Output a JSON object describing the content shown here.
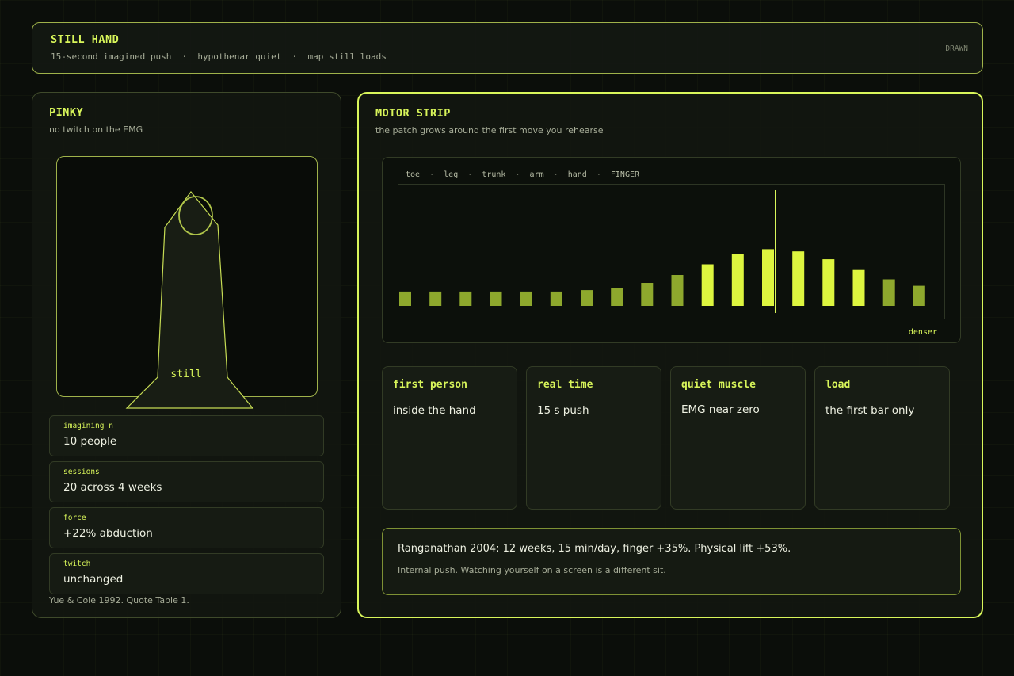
{
  "header": {
    "title": "STILL HAND",
    "subtitle": "15-second imagined push  ·  hypothenar quiet  ·  map still loads",
    "badge": "DRAWN"
  },
  "left": {
    "title": "PINKY",
    "subtitle": "no twitch on the EMG",
    "finger_label": "still",
    "stats": [
      {
        "label": "imagining n",
        "value": "10 people"
      },
      {
        "label": "sessions",
        "value": "20 across 4 weeks"
      },
      {
        "label": "force",
        "value": "+22% abduction"
      },
      {
        "label": "twitch",
        "value": "unchanged"
      }
    ],
    "footnote": "Yue & Cole 1992. Quote Table 1."
  },
  "right": {
    "title": "MOTOR STRIP",
    "subtitle": "the patch grows around the first move you rehearse",
    "chart_categories": "toe  ·  leg  ·  trunk  ·  arm  ·  hand  ·  FINGER",
    "chart_end_label": "denser",
    "cards": [
      {
        "title": "first person",
        "body": "inside the hand"
      },
      {
        "title": "real time",
        "body": "15 s push"
      },
      {
        "title": "quiet muscle",
        "body": "EMG near zero"
      },
      {
        "title": "load",
        "body": "the first bar only"
      }
    ],
    "note_main": "Ranganathan 2004: 12 weeks, 15 min/day, finger +35%. Physical lift +53%.",
    "note_sub": "Internal push. Watching yourself on a screen is a different sit."
  },
  "chart_data": {
    "type": "bar",
    "values": [
      20,
      20,
      20,
      20,
      20,
      20,
      22,
      25,
      32,
      43,
      58,
      72,
      79,
      76,
      65,
      50,
      37,
      28
    ],
    "highlight": [
      false,
      false,
      false,
      false,
      false,
      false,
      false,
      false,
      false,
      false,
      true,
      true,
      true,
      true,
      true,
      true,
      false,
      false
    ],
    "marker_index": 12,
    "ylim": [
      0,
      170
    ],
    "colors": {
      "base": "#8ea82d",
      "highlight": "#ddf53f",
      "marker": "#d8f55a"
    }
  }
}
